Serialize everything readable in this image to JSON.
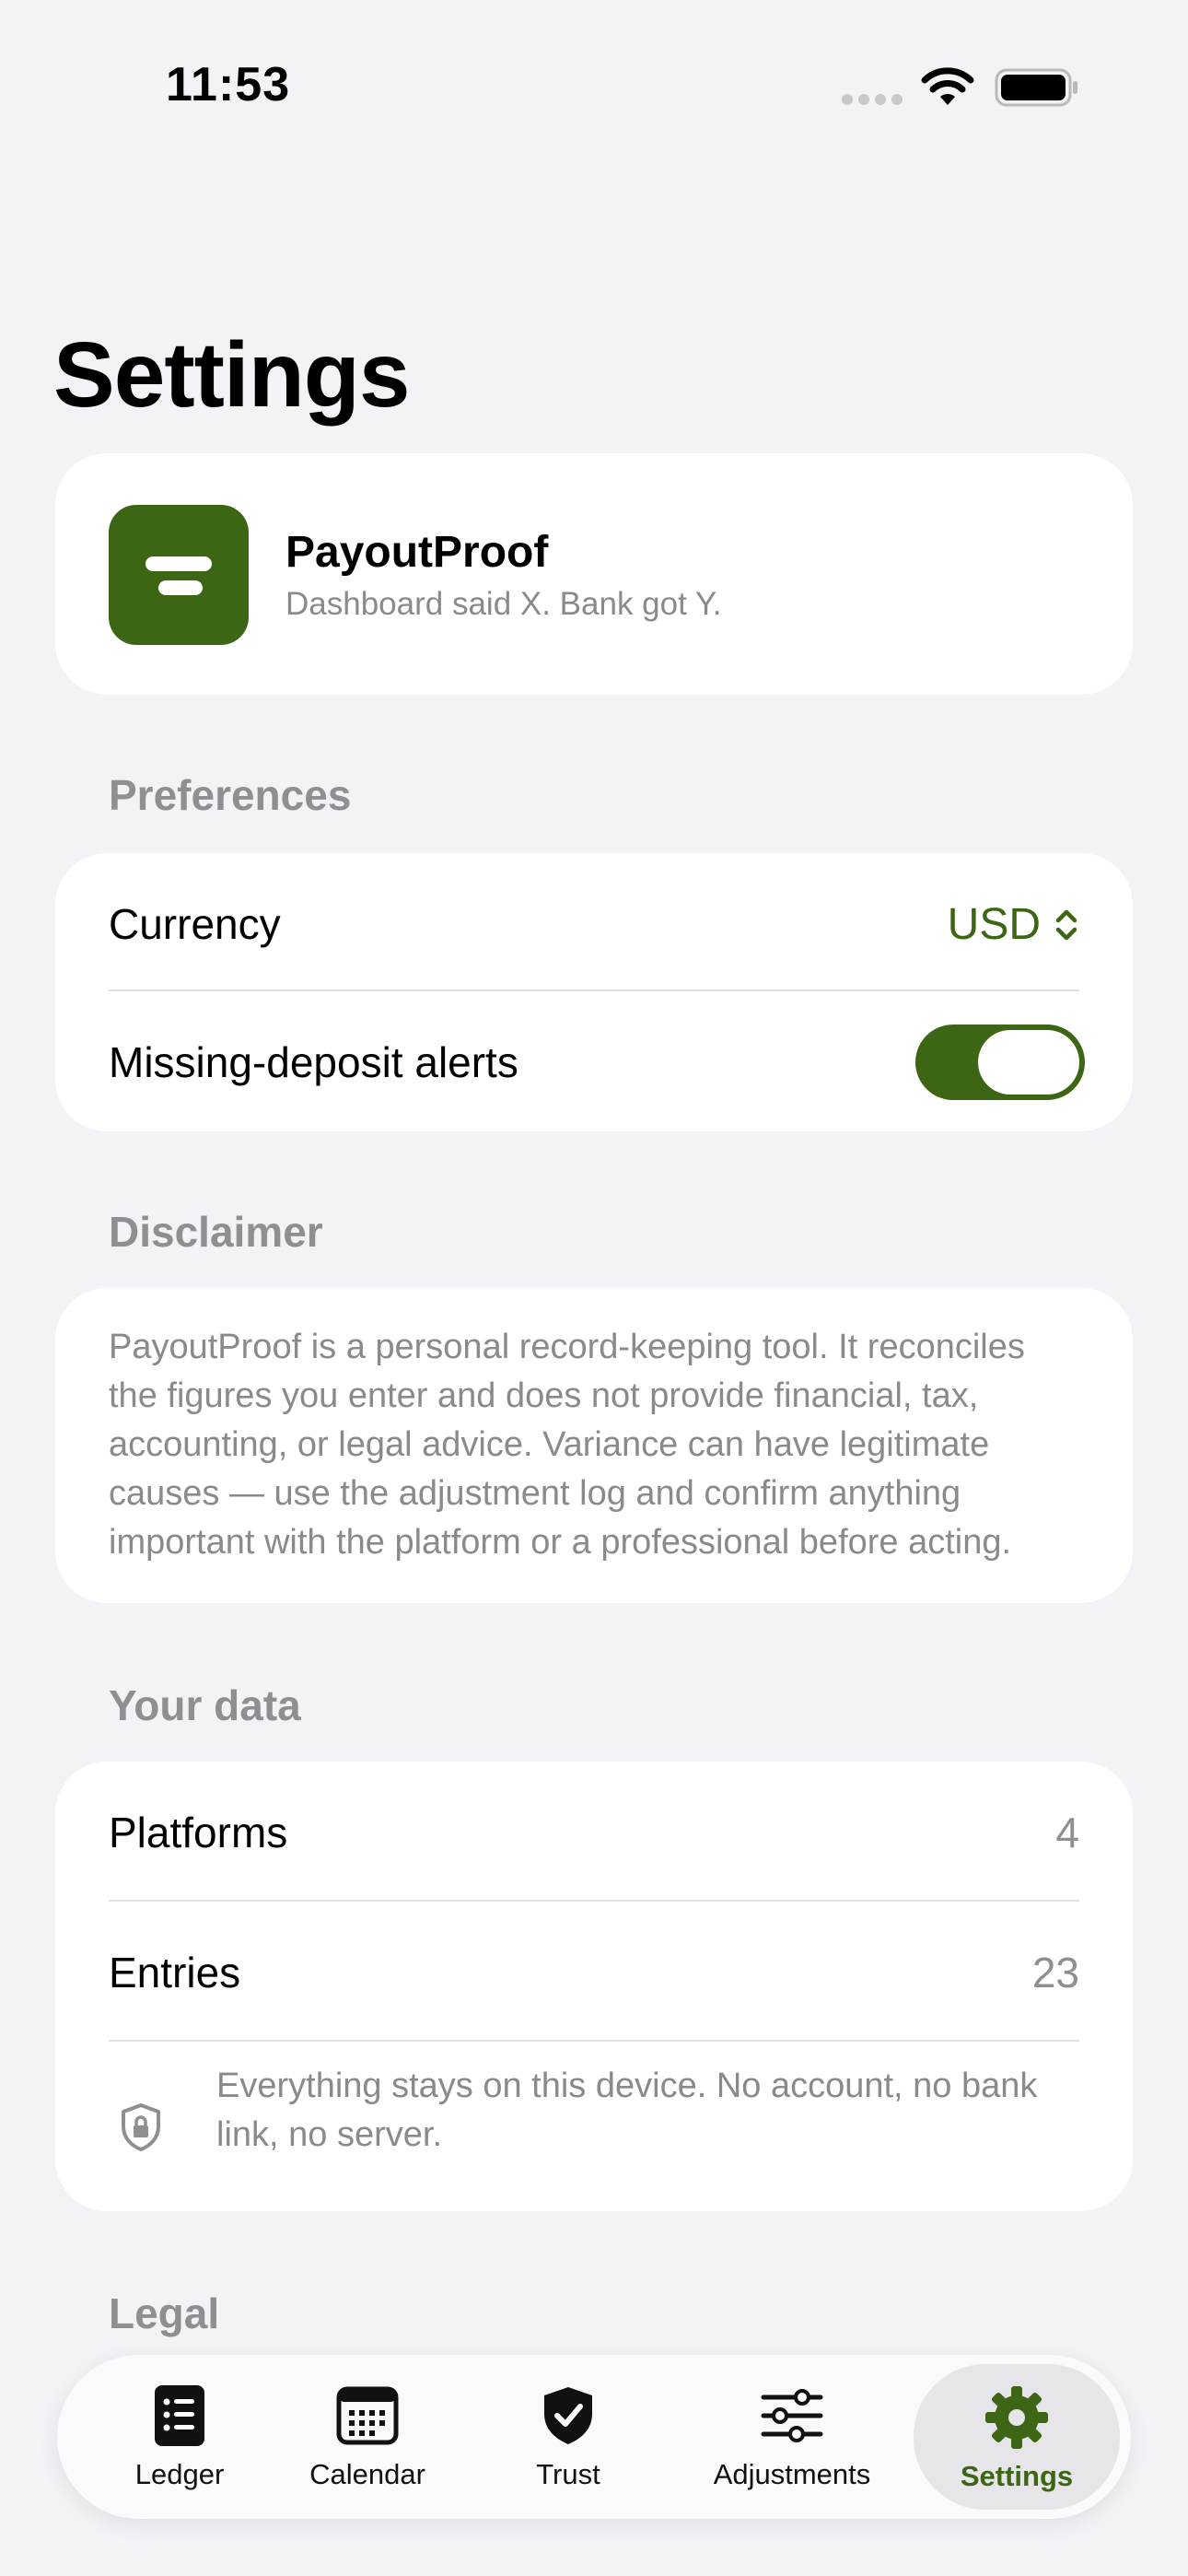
{
  "status_bar": {
    "time": "11:53"
  },
  "page": {
    "title": "Settings"
  },
  "app_card": {
    "name": "PayoutProof",
    "tagline": "Dashboard said X. Bank got Y."
  },
  "preferences": {
    "header": "Preferences",
    "currency_label": "Currency",
    "currency_value": "USD",
    "alerts_label": "Missing-deposit alerts",
    "alerts_enabled": true
  },
  "disclaimer": {
    "header": "Disclaimer",
    "text": "PayoutProof is a personal record-keeping tool. It reconciles the figures you enter and does not provide financial, tax, accounting, or legal advice. Variance can have legitimate causes — use the adjustment log and confirm anything important with the platform or a professional before acting."
  },
  "your_data": {
    "header": "Your data",
    "platforms_label": "Platforms",
    "platforms_count": "4",
    "entries_label": "Entries",
    "entries_count": "23",
    "privacy_note": "Everything stays on this device. No account, no bank link, no server."
  },
  "legal": {
    "header": "Legal"
  },
  "tab_bar": {
    "tabs": [
      {
        "label": "Ledger",
        "icon": "list-icon"
      },
      {
        "label": "Calendar",
        "icon": "calendar-icon"
      },
      {
        "label": "Trust",
        "icon": "shield-check-icon"
      },
      {
        "label": "Adjustments",
        "icon": "sliders-icon"
      },
      {
        "label": "Settings",
        "icon": "gear-icon",
        "active": true
      }
    ]
  },
  "colors": {
    "accent": "#3d6614",
    "background": "#f2f2f7",
    "secondary_text": "#8e8e93"
  }
}
